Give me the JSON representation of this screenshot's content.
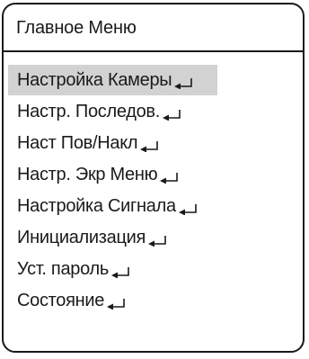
{
  "menu": {
    "title": "Главное Меню",
    "items": [
      {
        "label": "Настройка Камеры",
        "selected": true,
        "icon": "enter-return-icon"
      },
      {
        "label": "Настр. Последов.",
        "selected": false,
        "icon": "enter-return-icon"
      },
      {
        "label": "Наст Пов/Накл",
        "selected": false,
        "icon": "enter-return-icon"
      },
      {
        "label": "Настр. Экр Меню",
        "selected": false,
        "icon": "enter-return-icon"
      },
      {
        "label": "Настройка Сигнала",
        "selected": false,
        "icon": "enter-return-icon"
      },
      {
        "label": "Инициализация",
        "selected": false,
        "icon": "enter-return-icon"
      },
      {
        "label": "Уст. пароль",
        "selected": false,
        "icon": "enter-return-icon"
      },
      {
        "label": "Состояние",
        "selected": false,
        "icon": "enter-return-icon"
      }
    ]
  },
  "colors": {
    "border": "#1a1a1a",
    "selected_background": "#d2d2d2",
    "background": "#ffffff"
  }
}
